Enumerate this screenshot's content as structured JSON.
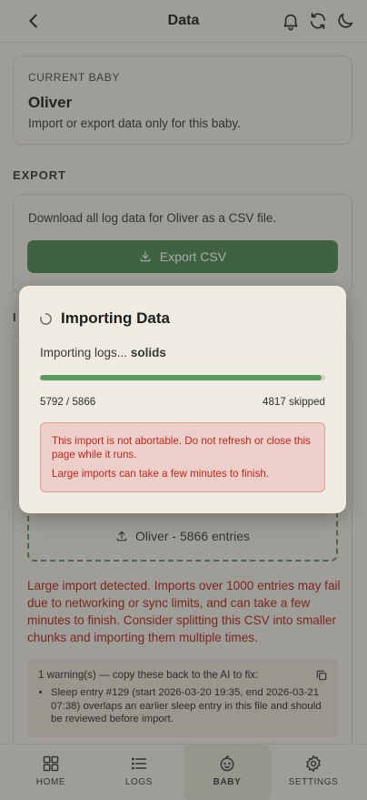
{
  "header": {
    "title": "Data"
  },
  "current_baby": {
    "label": "CURRENT BABY",
    "name": "Oliver",
    "description": "Import or export data only for this baby."
  },
  "export": {
    "section_title": "EXPORT",
    "description": "Download all log data for Oliver as a CSV file.",
    "button_label": "Export CSV"
  },
  "import": {
    "section_title_fragment": "I",
    "file_label": "Oliver - 5866 entries",
    "large_import_warning": "Large import detected. Imports over 1000 entries may fail due to networking or sync limits, and can take a few minutes to finish. Consider splitting this CSV into smaller chunks and importing them multiple times.",
    "warnings_title": "1 warning(s) — copy these back to the AI to fix:",
    "warnings": [
      "Sleep entry #129 (start 2026-03-20 19:35, end 2026-03-21 07:38) overlaps an earlier sleep entry in this file and should be reviewed before import."
    ]
  },
  "modal": {
    "title": "Importing Data",
    "status_prefix": "Importing logs...",
    "status_stage": "solids",
    "progress_done": 5792,
    "progress_total": 5866,
    "progress_text": "5792 / 5866",
    "skipped_text": "4817 skipped",
    "alert_primary": "This import is not abortable. Do not refresh or close this page while it runs.",
    "alert_secondary": "Large imports can take a few minutes to finish."
  },
  "nav": {
    "items": [
      {
        "label": "HOME",
        "icon": "grid-icon"
      },
      {
        "label": "LOGS",
        "icon": "list-icon"
      },
      {
        "label": "BABY",
        "icon": "baby-face-icon",
        "active": true
      },
      {
        "label": "SETTINGS",
        "icon": "gear-icon"
      }
    ]
  },
  "colors": {
    "accent": "#4f8a55",
    "error": "#c0261d",
    "background": "#efece4"
  }
}
